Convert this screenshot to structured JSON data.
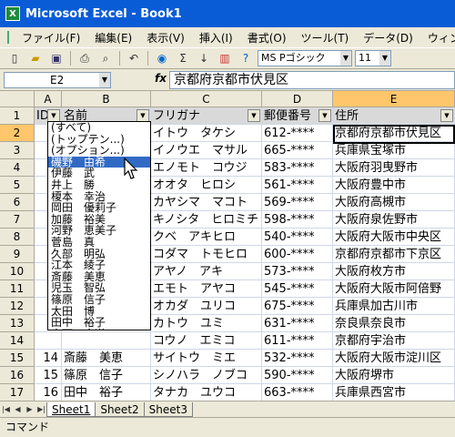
{
  "window": {
    "title": "Microsoft Excel - Book1"
  },
  "menu": [
    "ファイル(F)",
    "編集(E)",
    "表示(V)",
    "挿入(I)",
    "書式(O)",
    "ツール(T)",
    "データ(D)",
    "ウィンドウ(W)"
  ],
  "toolbar": {
    "font": "MS Pゴシック",
    "size": "11",
    "sigma": "Σ"
  },
  "formula_bar": {
    "name_box": "E2",
    "fx": "fx",
    "content": "京都府京都市伏見区"
  },
  "columns": [
    "A",
    "B",
    "C",
    "D",
    "E"
  ],
  "headers": [
    "ID",
    "名前",
    "フリガナ",
    "郵便番号",
    "住所"
  ],
  "rows": [
    {
      "n": "1"
    },
    {
      "n": "2",
      "id": "",
      "name": "",
      "kana": "イトウ　タケシ",
      "zip": "612-****",
      "addr": "京都府京都市伏見区"
    },
    {
      "n": "3",
      "id": "",
      "name": "",
      "kana": "イノウエ　マサル",
      "zip": "665-****",
      "addr": "兵庫県宝塚市"
    },
    {
      "n": "4",
      "id": "",
      "name": "",
      "kana": "エノモト　コウジ",
      "zip": "583-****",
      "addr": "大阪府羽曳野市"
    },
    {
      "n": "5",
      "id": "",
      "name": "",
      "kana": "オオタ　ヒロシ",
      "zip": "561-****",
      "addr": "大阪府豊中市"
    },
    {
      "n": "6",
      "id": "",
      "name": "",
      "kana": "カヤシマ　マコト",
      "zip": "569-****",
      "addr": "大阪府高槻市"
    },
    {
      "n": "7",
      "id": "",
      "name": "",
      "kana": "キノシタ　ヒロミチ",
      "zip": "598-****",
      "addr": "大阪府泉佐野市"
    },
    {
      "n": "8",
      "id": "",
      "name": "",
      "kana": "クベ　アキヒロ",
      "zip": "540-****",
      "addr": "大阪府大阪市中央区"
    },
    {
      "n": "9",
      "id": "",
      "name": "",
      "kana": "コダマ　トモヒロ",
      "zip": "600-****",
      "addr": "京都府京都市下京区"
    },
    {
      "n": "10",
      "id": "",
      "name": "",
      "kana": "アヤノ　アキ",
      "zip": "573-****",
      "addr": "大阪府枚方市"
    },
    {
      "n": "11",
      "id": "",
      "name": "",
      "kana": "エモト　アヤコ",
      "zip": "545-****",
      "addr": "大阪府大阪市阿倍野"
    },
    {
      "n": "12",
      "id": "",
      "name": "",
      "kana": "オカダ　ユリコ",
      "zip": "675-****",
      "addr": "兵庫県加古川市"
    },
    {
      "n": "13",
      "id": "",
      "name": "",
      "kana": "カトウ　ユミ",
      "zip": "631-****",
      "addr": "奈良県奈良市"
    },
    {
      "n": "14",
      "id": "",
      "name": "",
      "kana": "コウノ　エミコ",
      "zip": "611-****",
      "addr": "京都府宇治市"
    },
    {
      "n": "15",
      "id": "14",
      "name": "斎藤　美恵",
      "kana": "サイトウ　ミエ",
      "zip": "532-****",
      "addr": "大阪府大阪市淀川区"
    },
    {
      "n": "16",
      "id": "15",
      "name": "篠原　信子",
      "kana": "シノハラ　ノブコ",
      "zip": "590-****",
      "addr": "大阪府堺市"
    },
    {
      "n": "17",
      "id": "16",
      "name": "田中　裕子",
      "kana": "タナカ　ユウコ",
      "zip": "663-****",
      "addr": "兵庫県西宮市"
    },
    {
      "n": "18"
    }
  ],
  "dropdown": [
    "(すべて)",
    "(トップテン...)",
    "(オプション...)",
    "磯野　由希",
    "伊藤　武",
    "井上　勝",
    "榎本　幸治",
    "岡田　優莉子",
    "加藤　裕美",
    "河野　恵美子",
    "菅島　真",
    "久部　明弘",
    "江本　綾子",
    "斎藤　美恵",
    "児玉　智弘",
    "篠原　信子",
    "太田　博",
    "田中　裕子",
    "木下　宏道"
  ],
  "sheets": [
    "Sheet1",
    "Sheet2",
    "Sheet3"
  ],
  "status": "コマンド"
}
